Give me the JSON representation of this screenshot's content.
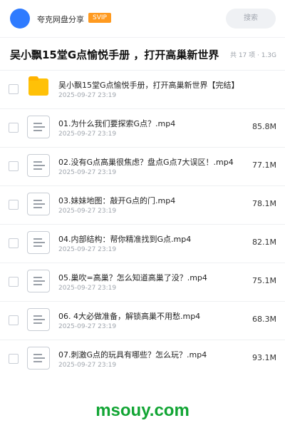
{
  "header": {
    "username": "夸克网盘分享",
    "vip_badge": "SVIP",
    "search_placeholder": "搜索"
  },
  "folder": {
    "title": "吴小飘15堂G点愉悦手册 ，打开高巢新世界",
    "meta": "共 17 项 · 1.3G"
  },
  "items": [
    {
      "name": "吴小飘15堂G点愉悦手册，打开高巢新世界【完结】",
      "date": "2025-09-27 23:19",
      "size": "",
      "type": "folder"
    },
    {
      "name": "01.为什么我们要探索G点？.mp4",
      "date": "2025-09-27 23:19",
      "size": "85.8M",
      "type": "file"
    },
    {
      "name": "02.没有G点高巢很焦虑？盘点G点7大误区！.mp4",
      "date": "2025-09-27 23:19",
      "size": "77.1M",
      "type": "file"
    },
    {
      "name": "03.妹妹地图：敲开G点的门.mp4",
      "date": "2025-09-27 23:19",
      "size": "78.1M",
      "type": "file"
    },
    {
      "name": "04.内部结构：帮你精准找到G点.mp4",
      "date": "2025-09-27 23:19",
      "size": "82.1M",
      "type": "file"
    },
    {
      "name": "05.巢吹=高巢？怎么知道高巢了没？.mp4",
      "date": "2025-09-27 23:19",
      "size": "75.1M",
      "type": "file"
    },
    {
      "name": "06. 4大必做准备，解锁高巢不用愁.mp4",
      "date": "2025-09-27 23:19",
      "size": "68.3M",
      "type": "file"
    },
    {
      "name": "07.刺激G点的玩具有哪些？怎么玩？.mp4",
      "date": "2025-09-27 23:19",
      "size": "93.1M",
      "type": "file"
    }
  ],
  "watermark": "msouy.com"
}
